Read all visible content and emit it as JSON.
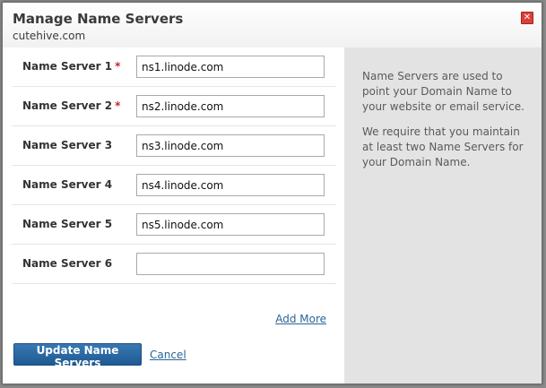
{
  "dialog": {
    "title": "Manage Name Servers",
    "domain": "cutehive.com",
    "close_icon": "close-icon",
    "close_glyph": "✕"
  },
  "name_servers": [
    {
      "label": "Name Server 1",
      "required": true,
      "value": "ns1.linode.com"
    },
    {
      "label": "Name Server 2",
      "required": true,
      "value": "ns2.linode.com"
    },
    {
      "label": "Name Server 3",
      "required": false,
      "value": "ns3.linode.com"
    },
    {
      "label": "Name Server 4",
      "required": false,
      "value": "ns4.linode.com"
    },
    {
      "label": "Name Server 5",
      "required": false,
      "value": "ns5.linode.com"
    },
    {
      "label": "Name Server 6",
      "required": false,
      "value": ""
    }
  ],
  "required_marker": "*",
  "actions": {
    "add_more": "Add More",
    "update": "Update Name Servers",
    "cancel": "Cancel"
  },
  "help": {
    "p1": "Name Servers are used to point your Domain Name to your website or email service.",
    "p2": "We require that you maintain at least two Name Servers for your Domain Name."
  },
  "colors": {
    "primary_button": "#2a6aa5",
    "close_button": "#d9403a",
    "required": "#c0282d",
    "link": "#2a6496",
    "help_panel": "#e3e3e3"
  }
}
